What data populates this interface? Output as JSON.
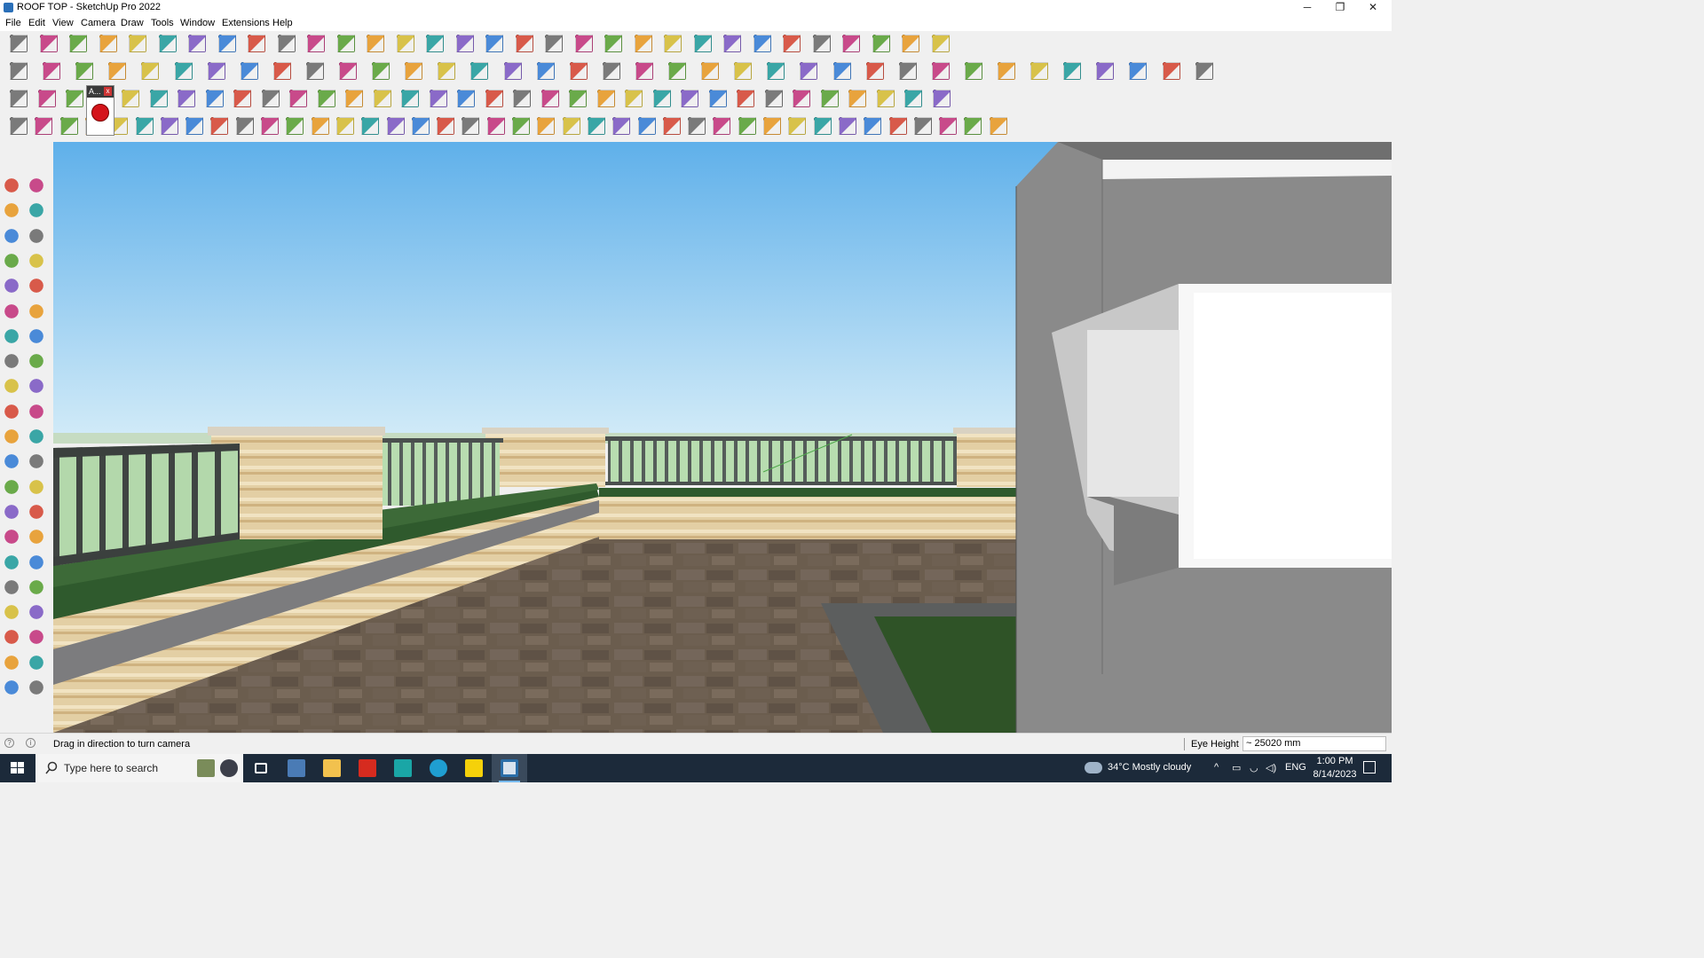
{
  "window": {
    "title": "ROOF TOP - SketchUp Pro 2022",
    "controls": {
      "minimize": "─",
      "restore": "❐",
      "close": "✕"
    }
  },
  "menu": [
    "File",
    "Edit",
    "View",
    "Camera",
    "Draw",
    "Tools",
    "Window",
    "Extensions",
    "Help"
  ],
  "floating_toolbar": {
    "title": "A...",
    "close": "x",
    "button_icon": "red-component-icon"
  },
  "toolbars": {
    "row1_icons": [
      "zoom-icon",
      "select-icon",
      "eraser-icon",
      "pencil-icon",
      "lasso-icon",
      "rectangle-icon",
      "push-pull-icon",
      "follow-me-icon",
      "move-icon",
      "rotate-icon",
      "scale-icon",
      "tape-measure-icon",
      "text-icon",
      "paint-bucket-icon",
      "orbit-icon",
      "pan-icon",
      "zoom-window-icon",
      "zoom-extents-icon",
      "sections-icon",
      "styles-icon",
      "layers-icon",
      "shadows-icon",
      "3d-warehouse-icon",
      "extension-warehouse-icon",
      "flip-icon",
      "align-icon",
      "distribute-icon",
      "fit-icon",
      "axis-icon",
      "undo-icon",
      "redo-icon",
      "erase-icon"
    ],
    "row2_icons": [
      "solid-box-icon",
      "outer-shell-icon",
      "intersect-icon",
      "union-icon",
      "subtract-icon",
      "trim-icon",
      "split-icon",
      "plugin-icon",
      "arrow-down-icon",
      "arrow-up-icon",
      "arrow-right-icon",
      "arrow-left-icon",
      "cube-icon",
      "curve-icon",
      "iso-view-icon",
      "top-view-icon",
      "front-view-icon",
      "right-view-icon",
      "back-view-icon",
      "left-view-icon",
      "house-icon",
      "roof-icon",
      "wall-icon",
      "bridge-icon",
      "shape-bezier-icon",
      "paint-icon",
      "rectangle-icon",
      "circle-icon",
      "polygon-icon",
      "ellipse-icon",
      "parallelogram-icon",
      "arc-icon",
      "spiral-icon",
      "star-icon",
      "helix-icon",
      "measure-icon",
      "eraser-icon"
    ],
    "row3_icons": [
      "plane-icon",
      "face-icon",
      "surface-icon",
      "arc-icon",
      "cut-icon",
      "panel-icon",
      "window-icon",
      "wood-icon",
      "pipe-icon",
      "chamfer-icon",
      "curve-icon",
      "plus-icon",
      "cross-icon",
      "diamond-icon",
      "cone-icon",
      "pyramid-icon",
      "tent-icon",
      "ring-icon",
      "knot-icon",
      "loop-icon",
      "star-icon",
      "bucket-icon",
      "magnet-icon",
      "tree-icon",
      "cube-stack-icon",
      "cubes-icon",
      "gift-icon",
      "mesh-icon",
      "fence-icon",
      "grid-icon",
      "tiles-icon",
      "dots-icon",
      "circle-dots-icon",
      "qr-icon"
    ],
    "row4_icons": [
      "path-icon",
      "bezier-icon",
      "car-icon",
      "shapes-icon",
      "loft-icon",
      "sweep-icon",
      "twist-icon",
      "mesh-icon",
      "sphere-icon",
      "curl-icon",
      "line-icon",
      "angle-icon",
      "line-icon",
      "corner-icon",
      "arch-icon",
      "wall-icon",
      "prism-icon",
      "column-icon",
      "column-icon",
      "hand-icon",
      "sheet-icon",
      "split-icon",
      "stairs-icon",
      "slope-icon",
      "ramp-icon",
      "rail-icon",
      "roof-icon",
      "hatch-icon",
      "stair-icon",
      "door-icon",
      "beam-icon",
      "truss-icon",
      "grid-icon",
      "hatch-icon",
      "fence-icon",
      "ornament-icon",
      "ornament-icon",
      "stripes-icon",
      "sun-icon",
      "cloud-icon"
    ]
  },
  "left_toolbar_icons": [
    "select-icon",
    "orbit-icon",
    "paint-bucket-icon",
    "eraser-icon",
    "component-icon",
    "tag-icon",
    "line-icon",
    "freehand-icon",
    "rectangle-icon",
    "rotated-rectangle-icon",
    "circle-icon",
    "polygon-icon",
    "arc-icon",
    "two-point-arc-icon",
    "three-point-arc-icon",
    "pie-icon",
    "move-icon",
    "push-pull-icon",
    "rotate-icon",
    "follow-me-icon",
    "scale-icon",
    "offset-icon",
    "tape-measure-icon",
    "dimension-icon",
    "protractor-icon",
    "text-icon",
    "axes-icon",
    "3d-text-icon",
    "orbit-icon",
    "pan-icon",
    "zoom-icon",
    "zoom-window-icon",
    "zoom-extents-icon",
    "previous-view-icon",
    "position-camera-icon",
    "look-around-icon",
    "walk-icon",
    "section-plane-icon",
    "sections-icon",
    "styles-icon",
    "layers-icon",
    "shadows-icon"
  ],
  "statusbar": {
    "message": "Drag in direction to turn camera",
    "vcb_label": "Eye Height",
    "vcb_value": "~ 25020 mm"
  },
  "taskbar": {
    "search_placeholder": "Type here to search",
    "apps": [
      "task-view-icon",
      "calculator-icon",
      "file-explorer-icon",
      "acrobat-icon",
      "3ds-max-icon",
      "edge-icon",
      "sticky-notes-icon",
      "sketchup-icon"
    ],
    "weather": "34°C  Mostly cloudy",
    "language": "ENG",
    "time": "1:00 PM",
    "date": "8/14/2023"
  }
}
